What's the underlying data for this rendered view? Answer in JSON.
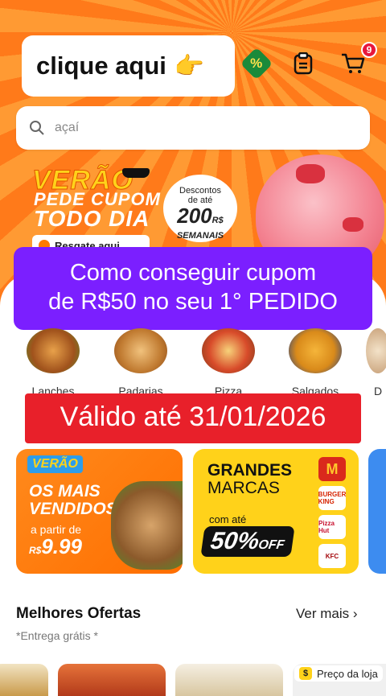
{
  "header": {
    "callout_text": "clique aqui",
    "callout_emoji": "👉",
    "cart_count": "9"
  },
  "search": {
    "placeholder": "açaí"
  },
  "hero_banner": {
    "title": "VERÃO",
    "line1": "PEDE CUPOM",
    "line2": "TODO DIA",
    "button_label": "Resgate aqui",
    "seal_line1": "Descontos",
    "seal_line2": "de até",
    "seal_amount": "200",
    "seal_currency": "R$",
    "seal_line3": "SEMANAIS"
  },
  "overlay_purple": {
    "line1": "Como conseguir cupom",
    "line2": "de R$50 no seu 1° PEDIDO"
  },
  "categories": [
    {
      "label": "Lanches"
    },
    {
      "label": "Padarias"
    },
    {
      "label": "Pizza"
    },
    {
      "label": "Salgados"
    },
    {
      "label": "D"
    }
  ],
  "overlay_red": {
    "text": "Válido até 31/01/2026"
  },
  "promo_cards": {
    "card1": {
      "tag": "VERÃO",
      "line1": "OS MAIS",
      "line2": "VENDIDOS",
      "prefix": "a partir de",
      "currency": "R$",
      "price": "9.99"
    },
    "card2": {
      "line1": "GRANDES",
      "line2": "MARCAS",
      "prefix": "com até",
      "discount": "50%",
      "off": "OFF",
      "brands": [
        "M",
        "BURGER KING",
        "Pizza Hut",
        "KFC"
      ]
    }
  },
  "section": {
    "title": "Melhores Ofertas",
    "subtitle": "*Entrega grátis *",
    "link": "Ver mais",
    "price_badge": "Preço da loja"
  },
  "colors": {
    "accent": "#ff7a1a",
    "purple": "#7b1fff",
    "red": "#e8202a",
    "yellow": "#ffd21a"
  }
}
